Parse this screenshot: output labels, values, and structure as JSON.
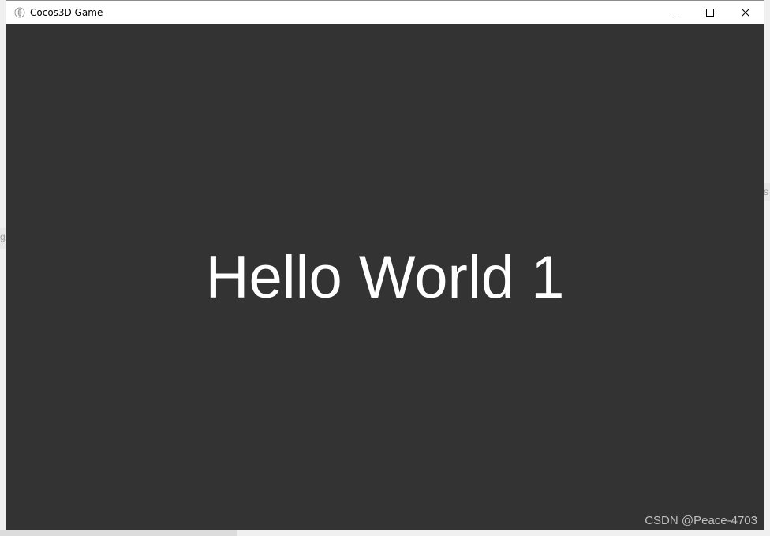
{
  "window": {
    "title": "Cocos3D Game",
    "icon": "cocos-app-icon",
    "buttons": {
      "minimize": "minimize-icon",
      "maximize": "maximize-icon",
      "close": "close-icon"
    }
  },
  "scene": {
    "label": "Hello World 1",
    "background_color": "#333333",
    "text_color": "#ffffff"
  },
  "watermark": "CSDN @Peace-4703",
  "background": {
    "left_fragment": "g",
    "right_fragment": "s"
  }
}
